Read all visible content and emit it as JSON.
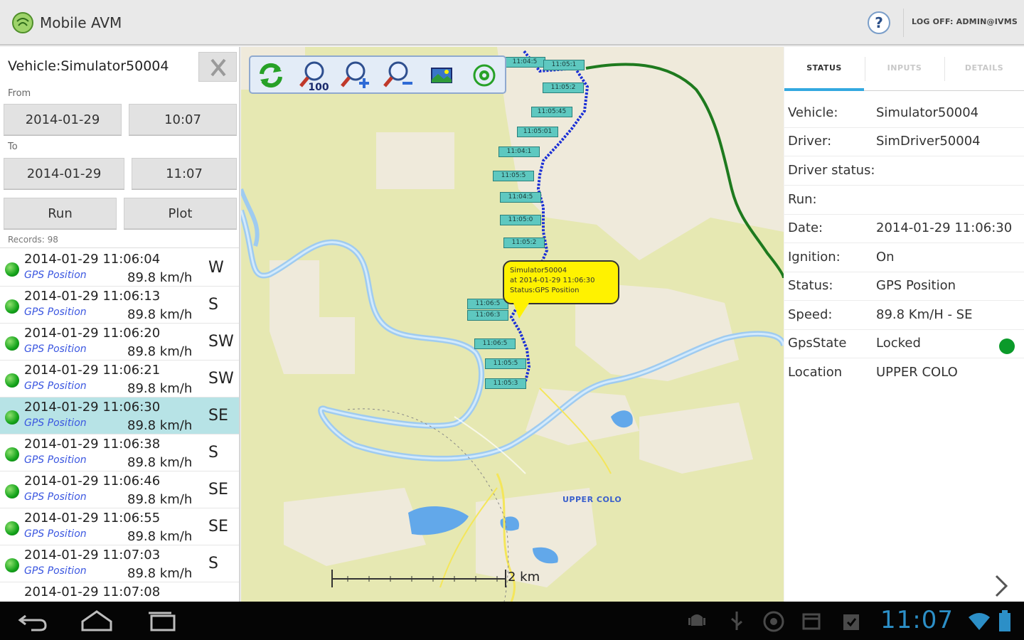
{
  "app": {
    "title": "Mobile AVM",
    "logoff": "LOG OFF: ADMIN@IVMS"
  },
  "left": {
    "vehicle_title": "Vehicle:Simulator50004",
    "from_label": "From",
    "to_label": "To",
    "from_date": "2014-01-29",
    "from_time": "10:07",
    "to_date": "2014-01-29",
    "to_time": "11:07",
    "run_label": "Run",
    "plot_label": "Plot",
    "records_label": "Records: 98",
    "rows": [
      {
        "datetime": "2014-01-29 11:06:04",
        "status": "GPS Position",
        "speed": "89.8 km/h",
        "dir": "W"
      },
      {
        "datetime": "2014-01-29 11:06:13",
        "status": "GPS Position",
        "speed": "89.8 km/h",
        "dir": "S"
      },
      {
        "datetime": "2014-01-29 11:06:20",
        "status": "GPS Position",
        "speed": "89.8 km/h",
        "dir": "SW"
      },
      {
        "datetime": "2014-01-29 11:06:21",
        "status": "GPS Position",
        "speed": "89.8 km/h",
        "dir": "SW"
      },
      {
        "datetime": "2014-01-29 11:06:30",
        "status": "GPS Position",
        "speed": "89.8 km/h",
        "dir": "SE",
        "selected": true
      },
      {
        "datetime": "2014-01-29 11:06:38",
        "status": "GPS Position",
        "speed": "89.8 km/h",
        "dir": "S"
      },
      {
        "datetime": "2014-01-29 11:06:46",
        "status": "GPS Position",
        "speed": "89.8 km/h",
        "dir": "SE"
      },
      {
        "datetime": "2014-01-29 11:06:55",
        "status": "GPS Position",
        "speed": "89.8 km/h",
        "dir": "SE"
      },
      {
        "datetime": "2014-01-29 11:07:03",
        "status": "GPS Position",
        "speed": "89.8 km/h",
        "dir": "S"
      },
      {
        "datetime": "2014-01-29 11:07:08",
        "status": "",
        "speed": "",
        "dir": ""
      }
    ]
  },
  "map": {
    "callout": {
      "line1": "Simulator50004",
      "line2": "at 2014-01-29 11:06:30",
      "line3": "Status:GPS Position"
    },
    "place_label": "UPPER COLO",
    "scale_label": "2 km",
    "track_labels": [
      "11:04:5",
      "11:05:1",
      "11:05:2",
      "11:05:45",
      "11:05:01",
      "11:04:1",
      "11:05:5",
      "11:04:5",
      "11:05:0",
      "11:05:2",
      "11:06:5",
      "11:06:3",
      "11:06:5",
      "11:05:5",
      "11:05:3"
    ]
  },
  "right": {
    "tabs": [
      "STATUS",
      "INPUTS",
      "DETAILS"
    ],
    "fields": [
      {
        "key": "Vehicle:",
        "value": "Simulator50004"
      },
      {
        "key": "Driver:",
        "value": "SimDriver50004"
      },
      {
        "key": "Driver status:",
        "value": ""
      },
      {
        "key": "Run:",
        "value": ""
      },
      {
        "key": "Date:",
        "value": "2014-01-29 11:06:30"
      },
      {
        "key": "Ignition:",
        "value": "On"
      },
      {
        "key": "Status:",
        "value": "GPS Position"
      },
      {
        "key": "Speed:",
        "value": "89.8 Km/H - SE"
      },
      {
        "key": "GpsState",
        "value": "Locked"
      },
      {
        "key": "Location",
        "value": "UPPER COLO"
      }
    ],
    "gps_state_color": "#0b9a2a"
  },
  "navbar": {
    "clock": "11:07"
  },
  "colors": {
    "accent": "#33a9e0",
    "selected_row": "#b7e3e6",
    "map_land": "#e7e8b0",
    "map_sand": "#efeadc",
    "river": "#aad3f7",
    "track": "#1b2fd6",
    "callout": "#fff200"
  }
}
